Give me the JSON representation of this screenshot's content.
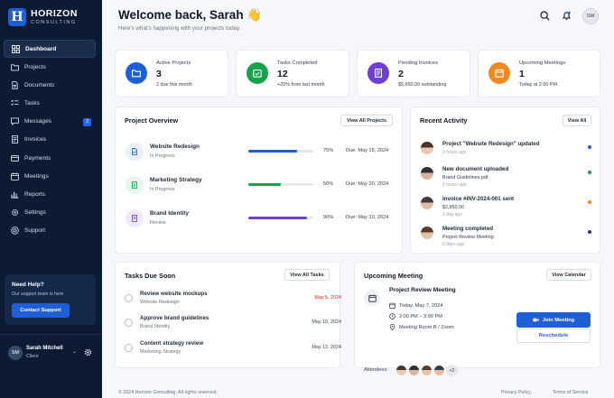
{
  "brand": {
    "name": "HORIZON",
    "sub": "CONSULTING",
    "logo_letter": "H"
  },
  "sidebar": {
    "items": [
      {
        "label": "Dashboard",
        "icon": "grid-icon",
        "active": true
      },
      {
        "label": "Projects",
        "icon": "folder-icon"
      },
      {
        "label": "Documents",
        "icon": "document-icon"
      },
      {
        "label": "Tasks",
        "icon": "checklist-icon"
      },
      {
        "label": "Messages",
        "icon": "chat-icon",
        "badge": "3"
      },
      {
        "label": "Invoices",
        "icon": "invoice-icon"
      },
      {
        "label": "Payments",
        "icon": "card-icon"
      },
      {
        "label": "Meetings",
        "icon": "calendar-icon"
      },
      {
        "label": "Reports",
        "icon": "chart-icon"
      },
      {
        "label": "Settings",
        "icon": "gear-icon"
      },
      {
        "label": "Support",
        "icon": "help-icon"
      }
    ],
    "help": {
      "title": "Need Help?",
      "sub": "Our support team is here",
      "button": "Contact Support"
    },
    "user": {
      "initials": "SM",
      "name": "Sarah Mitchell",
      "role": "Client"
    }
  },
  "header": {
    "title": "Welcome back, Sarah 👋",
    "subtitle": "Here's what's happening with your projects today.",
    "avatar": "SM"
  },
  "stats": [
    {
      "label": "Active Projects",
      "value": "3",
      "sub": "2 due this month",
      "color": "#1f5fd6",
      "icon": "folder-icon"
    },
    {
      "label": "Tasks Completed",
      "value": "12",
      "sub": "+20% from last month",
      "color": "#16a34a",
      "icon": "calendar-check-icon"
    },
    {
      "label": "Pending Invoices",
      "value": "2",
      "sub": "$5,650.00 outstanding",
      "color": "#6d3fd6",
      "icon": "invoice-icon"
    },
    {
      "label": "Upcoming Meetings",
      "value": "1",
      "sub": "Today at 2:00 PM",
      "color": "#f0891e",
      "icon": "calendar-icon"
    }
  ],
  "project_overview": {
    "title": "Project Overview",
    "button": "View All Projects",
    "projects": [
      {
        "name": "Website Redesign",
        "status": "In Progress",
        "progress": 75,
        "pct_label": "75%",
        "due": "Due: May 15, 2024",
        "color": "#1f5fd6",
        "bg": "#e8f0fd"
      },
      {
        "name": "Marketing Strategy",
        "status": "In Progress",
        "progress": 50,
        "pct_label": "50%",
        "due": "Due: May 20, 2024",
        "color": "#16a34a",
        "bg": "#e6f6ec"
      },
      {
        "name": "Brand Identity",
        "status": "Review",
        "progress": 90,
        "pct_label": "90%",
        "due": "Due: May 10, 2024",
        "color": "#6d3fd6",
        "bg": "#efe9fb"
      }
    ]
  },
  "recent_activity": {
    "title": "Recent Activity",
    "button": "View All",
    "items": [
      {
        "title": "Project \"Website Redesign\" updated",
        "detail": "",
        "time": "2 hours ago",
        "dot": "#1f5fd6"
      },
      {
        "title": "New document uploaded",
        "detail": "Brand Guidelines.pdf",
        "time": "5 hours ago",
        "dot": "#16a34a"
      },
      {
        "title": "Invoice #INV-2024-001 sent",
        "detail": "$2,850.00",
        "time": "1 day ago",
        "dot": "#f0891e"
      },
      {
        "title": "Meeting completed",
        "detail": "Project Review Meeting",
        "time": "2 days ago",
        "dot": "#1e3a8a"
      }
    ]
  },
  "tasks": {
    "title": "Tasks Due Soon",
    "button": "View All Tasks",
    "items": [
      {
        "title": "Review website mockups",
        "project": "Website Redesign",
        "due": "May 5, 2024",
        "overdue": true
      },
      {
        "title": "Approve brand guidelines",
        "project": "Brand Identity",
        "due": "May 10, 2024"
      },
      {
        "title": "Content strategy review",
        "project": "Marketing Strategy",
        "due": "May 12, 2024"
      }
    ]
  },
  "meeting": {
    "title": "Upcoming Meeting",
    "button": "View Calendar",
    "name": "Project Review Meeting",
    "date": "Today, May 7, 2024",
    "time": "2:00 PM – 3:00 PM",
    "location": "Meeting Room B / Zoom",
    "join": "Join Meeting",
    "reschedule": "Reschedule",
    "attendees_label": "Attendees:",
    "more": "+2"
  },
  "footer": {
    "copyright": "© 2024 Horizon Consulting. All rights reserved.",
    "privacy": "Privacy Policy",
    "terms": "Terms of Service"
  }
}
